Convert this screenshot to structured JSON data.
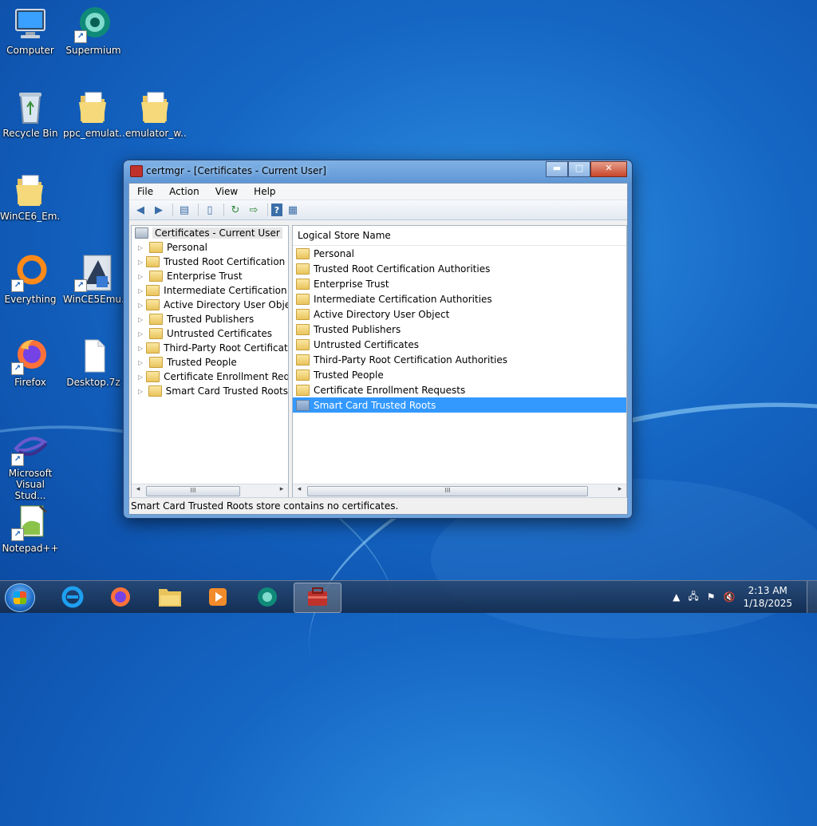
{
  "desktop": {
    "icons": [
      {
        "label": "Computer"
      },
      {
        "label": "Supermium"
      },
      {
        "label": "Recycle Bin"
      },
      {
        "label": "ppc_emulat..."
      },
      {
        "label": "emulator_w..."
      },
      {
        "label": "WinCE6_Em..."
      },
      {
        "label": "Everything"
      },
      {
        "label": "WinCE5Emu..."
      },
      {
        "label": "Firefox"
      },
      {
        "label": "Desktop.7z"
      },
      {
        "label": "Microsoft Visual Stud..."
      },
      {
        "label": "Notepad++"
      }
    ]
  },
  "window": {
    "title": "certmgr - [Certificates - Current User]",
    "controls": {
      "minimize": "▬",
      "maximize": "□",
      "close": "✕"
    },
    "menu": [
      "File",
      "Action",
      "View",
      "Help"
    ],
    "toolbar": {
      "icons": [
        "back-arrow-icon",
        "forward-arrow-icon",
        "show-hide-tree-icon",
        "clipboard-icon",
        "refresh-icon",
        "export-icon",
        "help-icon",
        "properties-icon"
      ]
    },
    "tree": {
      "root": "Certificates - Current User",
      "items": [
        "Personal",
        "Trusted Root Certification Au",
        "Enterprise Trust",
        "Intermediate Certification Au",
        "Active Directory User Object",
        "Trusted Publishers",
        "Untrusted Certificates",
        "Third-Party Root Certification",
        "Trusted People",
        "Certificate Enrollment Reques",
        "Smart Card Trusted Roots"
      ]
    },
    "list": {
      "column": "Logical Store Name",
      "items": [
        "Personal",
        "Trusted Root Certification Authorities",
        "Enterprise Trust",
        "Intermediate Certification Authorities",
        "Active Directory User Object",
        "Trusted Publishers",
        "Untrusted Certificates",
        "Third-Party Root Certification Authorities",
        "Trusted People",
        "Certificate Enrollment Requests",
        "Smart Card Trusted Roots"
      ],
      "selected_index": 10
    },
    "status": "Smart Card Trusted Roots store contains no certificates."
  },
  "taskbar": {
    "apps": [
      "internet-explorer-icon",
      "firefox-icon",
      "file-explorer-icon",
      "media-player-icon",
      "supermium-icon",
      "certmgr-icon"
    ],
    "active_app": "certmgr-icon",
    "tray": {
      "time": "2:13 AM",
      "date": "1/18/2025"
    }
  }
}
